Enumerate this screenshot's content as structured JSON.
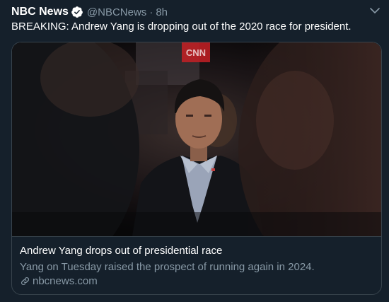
{
  "tweet": {
    "author_name": "NBC News",
    "handle": "@NBCNews",
    "separator": "·",
    "time": "8h",
    "text": "BREAKING: Andrew Yang is dropping out of the 2020 race for president."
  },
  "card": {
    "image_text": "CNN",
    "title": "Andrew Yang drops out of presidential race",
    "description": "Yang on Tuesday raised the prospect of running again in 2024.",
    "domain": "nbcnews.com"
  },
  "icons": {
    "verified": "verified-badge-icon",
    "menu": "chevron-down-icon",
    "link": "link-icon"
  },
  "colors": {
    "background": "#15202b",
    "secondary_text": "#8899a6",
    "border": "#38444d",
    "verified_badge": "#ffffff"
  }
}
